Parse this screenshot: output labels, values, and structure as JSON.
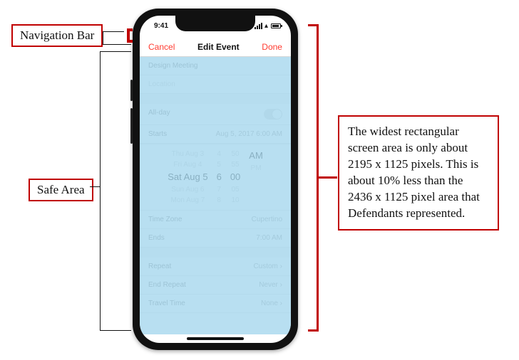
{
  "labels": {
    "navigation_bar": "Navigation Bar",
    "safe_area": "Safe Area"
  },
  "description": "The widest rectangular screen area is only about 2195 x 1125 pixels. This is about 10% less than the 2436 x 1125 pixel area that Defendants represented.",
  "status": {
    "time": "9:41"
  },
  "navbar": {
    "cancel": "Cancel",
    "title": "Edit Event",
    "done": "Done"
  },
  "event": {
    "title_field": "Design Meeting",
    "location_field": "Location",
    "allday_label": "All-day",
    "starts_label": "Starts",
    "starts_value": "Aug 5, 2017   6:00 AM",
    "picker": {
      "r0": {
        "date": "Thu Aug 3",
        "h": "4",
        "m": "50",
        "ampm": ""
      },
      "r1": {
        "date": "Fri Aug 4",
        "h": "5",
        "m": "55",
        "ampm": ""
      },
      "r2": {
        "date": "Sat Aug 5",
        "h": "6",
        "m": "00",
        "ampm": "AM"
      },
      "r3": {
        "date": "Sun Aug 6",
        "h": "7",
        "m": "05",
        "ampm": "PM"
      },
      "r4": {
        "date": "Mon Aug 7",
        "h": "8",
        "m": "10",
        "ampm": ""
      }
    },
    "ends_label": "Ends",
    "ends_value": "7:00 AM",
    "timezone_label": "Time Zone",
    "timezone_value": "Cupertino",
    "repeat_label": "Repeat",
    "repeat_value": "Custom  ›",
    "endrepeat_label": "End Repeat",
    "endrepeat_value": "Never  ›",
    "travel_label": "Travel Time",
    "travel_value": "None  ›"
  }
}
